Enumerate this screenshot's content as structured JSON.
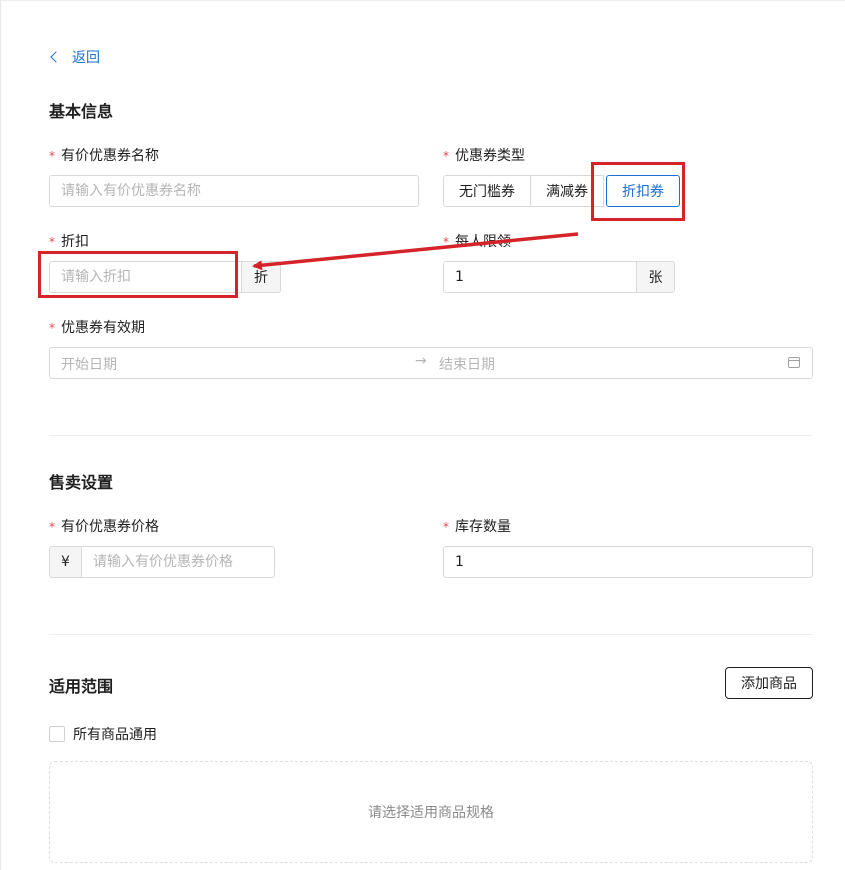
{
  "back": {
    "label": "返回"
  },
  "basic": {
    "title": "基本信息",
    "name_label": "有价优惠券名称",
    "name_placeholder": "请输入有价优惠券名称",
    "type_label": "优惠券类型",
    "type_options": [
      "无门槛券",
      "满减券",
      "折扣券"
    ],
    "type_selected": "折扣券",
    "discount_label": "折扣",
    "discount_placeholder": "请输入折扣",
    "discount_suffix": "折",
    "limit_label": "每人限领",
    "limit_value": "1",
    "limit_suffix": "张",
    "validity_label": "优惠券有效期",
    "validity_start_placeholder": "开始日期",
    "validity_separator": "→",
    "validity_end_placeholder": "结束日期"
  },
  "sale": {
    "title": "售卖设置",
    "price_label": "有价优惠券价格",
    "price_prefix": "¥",
    "price_placeholder": "请输入有价优惠券价格",
    "stock_label": "库存数量",
    "stock_value": "1"
  },
  "scope": {
    "title": "适用范围",
    "add_button": "添加商品",
    "all_products_label": "所有商品通用",
    "all_products_checked": false,
    "empty_text": "请选择适用商品规格"
  },
  "colors": {
    "accent": "#1a6fd1",
    "required": "#e5484d",
    "annotation": "#d4242a"
  },
  "required_mark": "*"
}
